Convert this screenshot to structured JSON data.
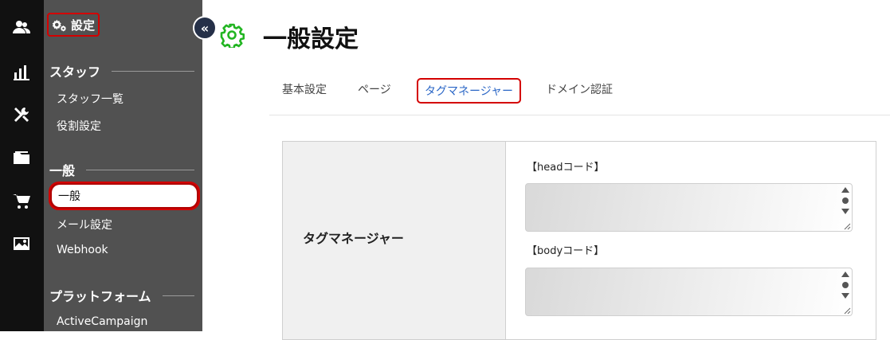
{
  "rail": {
    "icons": [
      "users-icon",
      "chart-icon",
      "tools-icon",
      "folder-icon",
      "cart-icon",
      "image-icon"
    ]
  },
  "sidebar": {
    "title": "設定",
    "sections": [
      {
        "heading": "スタッフ",
        "items": [
          "スタッフ一覧",
          "役割設定"
        ]
      },
      {
        "heading": "一般",
        "items": [
          "一般",
          "メール設定",
          "Webhook"
        ]
      },
      {
        "heading": "プラットフォーム",
        "items": [
          "ActiveCampaign"
        ]
      }
    ],
    "active_item": "一般"
  },
  "collapse_label": "«",
  "page": {
    "title": "一般設定"
  },
  "tabs": [
    {
      "label": "基本設定"
    },
    {
      "label": "ページ"
    },
    {
      "label": "タグマネージャー"
    },
    {
      "label": "ドメイン認証"
    }
  ],
  "active_tab": "タグマネージャー",
  "panel": {
    "label": "タグマネージャー",
    "head_label": "【headコード】",
    "body_label": "【bodyコード】",
    "head_value": "",
    "body_value": ""
  },
  "colors": {
    "rail": "#111111",
    "sidebar": "#515151",
    "highlight": "#d40000",
    "tab_active": "#2a66c6",
    "gear": "#22b522"
  }
}
